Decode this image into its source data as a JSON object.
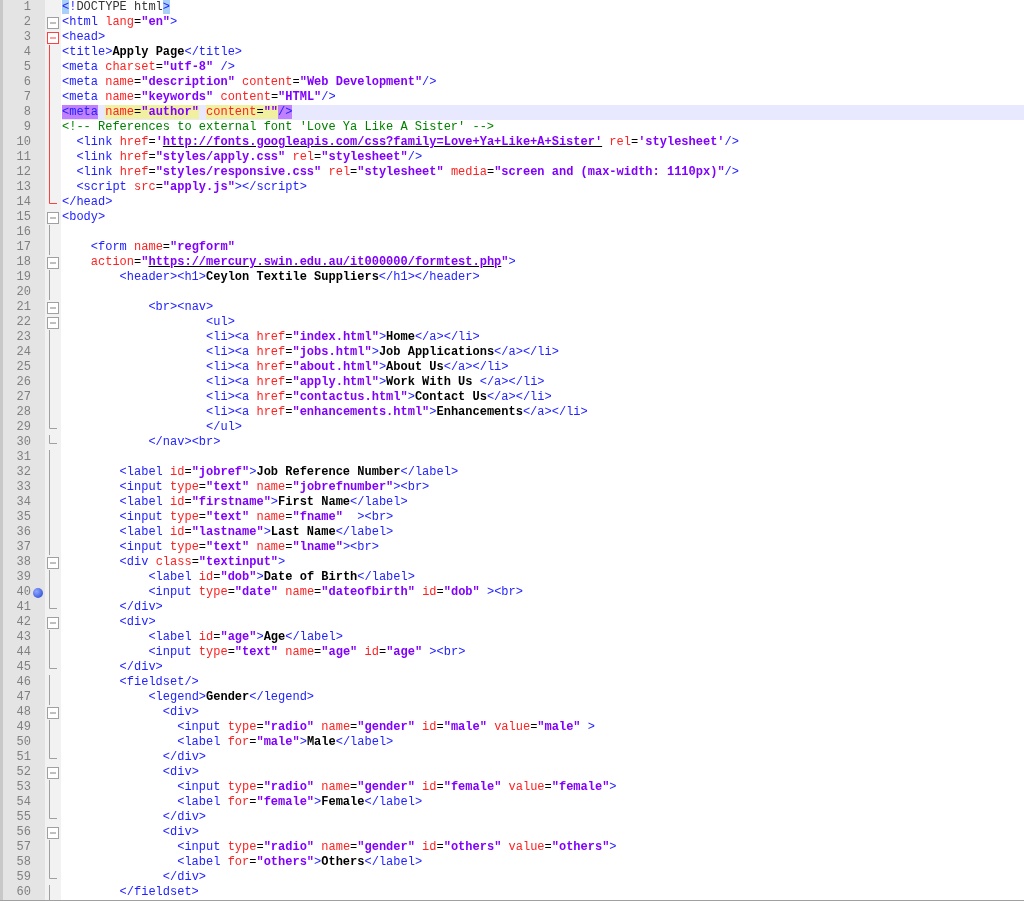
{
  "editor": {
    "lines": [
      {
        "number": "1",
        "current": false,
        "bookmarked": false,
        "tokens": [
          {
            "kind": "tag",
            "text": "<",
            "brace_match": true
          },
          {
            "kind": "tag",
            "text": "!"
          },
          {
            "kind": "plain",
            "text": "DOCTYPE html"
          },
          {
            "kind": "tag",
            "text": ">",
            "brace_match": true
          }
        ]
      },
      {
        "number": "2",
        "current": false,
        "bookmarked": false,
        "fold_start": true,
        "tokens": [
          {
            "kind": "tag",
            "text": "<html"
          },
          {
            "kind": "attr",
            "text": " lang"
          },
          {
            "kind": "op",
            "text": "="
          },
          {
            "kind": "value",
            "text": "\"en\""
          },
          {
            "kind": "tag",
            "text": ">"
          }
        ]
      },
      {
        "number": "3",
        "current": false,
        "bookmarked": false,
        "fold_start": true,
        "in_active_block": true,
        "tokens": [
          {
            "kind": "tag",
            "text": "<head>"
          }
        ]
      },
      {
        "number": "4",
        "current": false,
        "bookmarked": false,
        "in_active_block": true,
        "tokens": [
          {
            "kind": "tag",
            "text": "<title>"
          },
          {
            "kind": "text",
            "text": "Apply Page"
          },
          {
            "kind": "tag",
            "text": "</title>"
          }
        ]
      },
      {
        "number": "5",
        "current": false,
        "bookmarked": false,
        "in_active_block": true,
        "tokens": [
          {
            "kind": "tag",
            "text": "<meta"
          },
          {
            "kind": "attr",
            "text": " charset"
          },
          {
            "kind": "op",
            "text": "="
          },
          {
            "kind": "value",
            "text": "\"utf-8\""
          },
          {
            "kind": "tag",
            "text": " />"
          }
        ]
      },
      {
        "number": "6",
        "current": false,
        "bookmarked": false,
        "in_active_block": true,
        "tokens": [
          {
            "kind": "tag",
            "text": "<meta"
          },
          {
            "kind": "attr",
            "text": " name"
          },
          {
            "kind": "op",
            "text": "="
          },
          {
            "kind": "value",
            "text": "\"description\""
          },
          {
            "kind": "attr",
            "text": " content"
          },
          {
            "kind": "op",
            "text": "="
          },
          {
            "kind": "value",
            "text": "\"Web Development\""
          },
          {
            "kind": "tag",
            "text": "/>"
          }
        ]
      },
      {
        "number": "7",
        "current": false,
        "bookmarked": false,
        "in_active_block": true,
        "tokens": [
          {
            "kind": "tag",
            "text": "<meta"
          },
          {
            "kind": "attr",
            "text": " name"
          },
          {
            "kind": "op",
            "text": "="
          },
          {
            "kind": "value",
            "text": "\"keywords\""
          },
          {
            "kind": "attr",
            "text": " content"
          },
          {
            "kind": "op",
            "text": "="
          },
          {
            "kind": "value",
            "text": "\"HTML\""
          },
          {
            "kind": "tag",
            "text": "/>"
          }
        ]
      },
      {
        "number": "8",
        "current": true,
        "bookmarked": false,
        "in_active_block": true,
        "tokens": [
          {
            "kind": "tag",
            "text": "<meta",
            "tag_match": true
          },
          {
            "kind": "attr",
            "text": " name",
            "smart_highlight": true
          },
          {
            "kind": "op",
            "text": "=",
            "smart_highlight": true
          },
          {
            "kind": "value",
            "text": "\"author\"",
            "smart_highlight": true
          },
          {
            "kind": "attr",
            "text": " content",
            "smart_highlight": true
          },
          {
            "kind": "op",
            "text": "=",
            "smart_highlight": true
          },
          {
            "kind": "value",
            "text": "\"\"",
            "smart_highlight": true
          },
          {
            "kind": "tag",
            "text": "/>",
            "tag_match": true
          }
        ]
      },
      {
        "number": "9",
        "current": false,
        "bookmarked": false,
        "in_active_block": true,
        "tokens": [
          {
            "kind": "comment",
            "text": "<!-- References to external font 'Love Ya Like A Sister' -->"
          }
        ]
      },
      {
        "number": "10",
        "current": false,
        "bookmarked": false,
        "in_active_block": true,
        "tokens": [
          {
            "kind": "tag",
            "text": "  <link"
          },
          {
            "kind": "attr",
            "text": " href"
          },
          {
            "kind": "op",
            "text": "="
          },
          {
            "kind": "value",
            "text": "'"
          },
          {
            "kind": "link",
            "text": "http://fonts.googleapis.com/css?family=Love+Ya+Like+A+Sister'"
          },
          {
            "kind": "attr",
            "text": " rel"
          },
          {
            "kind": "op",
            "text": "="
          },
          {
            "kind": "value",
            "text": "'stylesheet'"
          },
          {
            "kind": "tag",
            "text": "/>"
          }
        ]
      },
      {
        "number": "11",
        "current": false,
        "bookmarked": false,
        "in_active_block": true,
        "tokens": [
          {
            "kind": "tag",
            "text": "  <link"
          },
          {
            "kind": "attr",
            "text": " href"
          },
          {
            "kind": "op",
            "text": "="
          },
          {
            "kind": "value",
            "text": "\"styles/apply.css\""
          },
          {
            "kind": "attr",
            "text": " rel"
          },
          {
            "kind": "op",
            "text": "="
          },
          {
            "kind": "value",
            "text": "\"stylesheet\""
          },
          {
            "kind": "tag",
            "text": "/>"
          }
        ]
      },
      {
        "number": "12",
        "current": false,
        "bookmarked": false,
        "in_active_block": true,
        "tokens": [
          {
            "kind": "tag",
            "text": "  <link"
          },
          {
            "kind": "attr",
            "text": " href"
          },
          {
            "kind": "op",
            "text": "="
          },
          {
            "kind": "value",
            "text": "\"styles/responsive.css\""
          },
          {
            "kind": "attr",
            "text": " rel"
          },
          {
            "kind": "op",
            "text": "="
          },
          {
            "kind": "value",
            "text": "\"stylesheet\""
          },
          {
            "kind": "attr",
            "text": " media"
          },
          {
            "kind": "op",
            "text": "="
          },
          {
            "kind": "value",
            "text": "\"screen and (max-width: 1110px)\""
          },
          {
            "kind": "tag",
            "text": "/>"
          }
        ]
      },
      {
        "number": "13",
        "current": false,
        "bookmarked": false,
        "in_active_block": true,
        "tokens": [
          {
            "kind": "tag",
            "text": "  <script"
          },
          {
            "kind": "attr",
            "text": " src"
          },
          {
            "kind": "op",
            "text": "="
          },
          {
            "kind": "value",
            "text": "\"apply.js\""
          },
          {
            "kind": "tag",
            "text": "></script>"
          }
        ]
      },
      {
        "number": "14",
        "current": false,
        "bookmarked": false,
        "fold_end": true,
        "in_active_block": true,
        "tokens": [
          {
            "kind": "tag",
            "text": "</head>"
          }
        ]
      },
      {
        "number": "15",
        "current": false,
        "bookmarked": false,
        "fold_start": true,
        "tokens": [
          {
            "kind": "tag",
            "text": "<body>"
          }
        ]
      },
      {
        "number": "16",
        "current": false,
        "bookmarked": false
      },
      {
        "number": "17",
        "current": false,
        "bookmarked": false,
        "tokens": [
          {
            "kind": "tag",
            "text": "    <form"
          },
          {
            "kind": "attr",
            "text": " name"
          },
          {
            "kind": "op",
            "text": "="
          },
          {
            "kind": "value",
            "text": "\"regform\""
          }
        ]
      },
      {
        "number": "18",
        "current": false,
        "bookmarked": false,
        "fold_start": true,
        "tokens": [
          {
            "kind": "attr",
            "text": "    action"
          },
          {
            "kind": "op",
            "text": "="
          },
          {
            "kind": "value",
            "text": "\""
          },
          {
            "kind": "link",
            "text": "https://mercury.swin.edu.au/it000000/formtest.php"
          },
          {
            "kind": "value",
            "text": "\""
          },
          {
            "kind": "tag",
            "text": ">"
          }
        ]
      },
      {
        "number": "19",
        "current": false,
        "bookmarked": false,
        "tokens": [
          {
            "kind": "tag",
            "text": "        <header><h1>"
          },
          {
            "kind": "text",
            "text": "Ceylon Textile Suppliers"
          },
          {
            "kind": "tag",
            "text": "</h1></header>"
          }
        ]
      },
      {
        "number": "20",
        "current": false,
        "bookmarked": false
      },
      {
        "number": "21",
        "current": false,
        "bookmarked": false,
        "fold_start": true,
        "tokens": [
          {
            "kind": "tag",
            "text": "            <br><nav>"
          }
        ]
      },
      {
        "number": "22",
        "current": false,
        "bookmarked": false,
        "fold_start": true,
        "tokens": [
          {
            "kind": "tag",
            "text": "                    <ul>"
          }
        ]
      },
      {
        "number": "23",
        "current": false,
        "bookmarked": false,
        "tokens": [
          {
            "kind": "tag",
            "text": "                    <li><a"
          },
          {
            "kind": "attr",
            "text": " href"
          },
          {
            "kind": "op",
            "text": "="
          },
          {
            "kind": "value",
            "text": "\"index.html\""
          },
          {
            "kind": "tag",
            "text": ">"
          },
          {
            "kind": "text",
            "text": "Home"
          },
          {
            "kind": "tag",
            "text": "</a></li>"
          }
        ]
      },
      {
        "number": "24",
        "current": false,
        "bookmarked": false,
        "tokens": [
          {
            "kind": "tag",
            "text": "                    <li><a"
          },
          {
            "kind": "attr",
            "text": " href"
          },
          {
            "kind": "op",
            "text": "="
          },
          {
            "kind": "value",
            "text": "\"jobs.html\""
          },
          {
            "kind": "tag",
            "text": ">"
          },
          {
            "kind": "text",
            "text": "Job Applications"
          },
          {
            "kind": "tag",
            "text": "</a></li>"
          }
        ]
      },
      {
        "number": "25",
        "current": false,
        "bookmarked": false,
        "tokens": [
          {
            "kind": "tag",
            "text": "                    <li><a"
          },
          {
            "kind": "attr",
            "text": " href"
          },
          {
            "kind": "op",
            "text": "="
          },
          {
            "kind": "value",
            "text": "\"about.html\""
          },
          {
            "kind": "tag",
            "text": ">"
          },
          {
            "kind": "text",
            "text": "About Us"
          },
          {
            "kind": "tag",
            "text": "</a></li>"
          }
        ]
      },
      {
        "number": "26",
        "current": false,
        "bookmarked": false,
        "tokens": [
          {
            "kind": "tag",
            "text": "                    <li><a"
          },
          {
            "kind": "attr",
            "text": " href"
          },
          {
            "kind": "op",
            "text": "="
          },
          {
            "kind": "value",
            "text": "\"apply.html\""
          },
          {
            "kind": "tag",
            "text": ">"
          },
          {
            "kind": "text",
            "text": "Work With Us"
          },
          {
            "kind": "tag",
            "text": " </a></li>"
          }
        ]
      },
      {
        "number": "27",
        "current": false,
        "bookmarked": false,
        "tokens": [
          {
            "kind": "tag",
            "text": "                    <li><a"
          },
          {
            "kind": "attr",
            "text": " href"
          },
          {
            "kind": "op",
            "text": "="
          },
          {
            "kind": "value",
            "text": "\"contactus.html\""
          },
          {
            "kind": "tag",
            "text": ">"
          },
          {
            "kind": "text",
            "text": "Contact Us"
          },
          {
            "kind": "tag",
            "text": "</a></li>"
          }
        ]
      },
      {
        "number": "28",
        "current": false,
        "bookmarked": false,
        "tokens": [
          {
            "kind": "tag",
            "text": "                    <li><a"
          },
          {
            "kind": "attr",
            "text": " href"
          },
          {
            "kind": "op",
            "text": "="
          },
          {
            "kind": "value",
            "text": "\"enhancements.html\""
          },
          {
            "kind": "tag",
            "text": ">"
          },
          {
            "kind": "text",
            "text": "Enhancements"
          },
          {
            "kind": "tag",
            "text": "</a></li>"
          }
        ]
      },
      {
        "number": "29",
        "current": false,
        "bookmarked": false,
        "fold_end": true,
        "tokens": [
          {
            "kind": "tag",
            "text": "                    </ul>"
          }
        ]
      },
      {
        "number": "30",
        "current": false,
        "bookmarked": false,
        "fold_end": true,
        "tokens": [
          {
            "kind": "tag",
            "text": "            </nav><br>"
          }
        ]
      },
      {
        "number": "31",
        "current": false,
        "bookmarked": false
      },
      {
        "number": "32",
        "current": false,
        "bookmarked": false,
        "tokens": [
          {
            "kind": "tag",
            "text": "        <label"
          },
          {
            "kind": "attr",
            "text": " id"
          },
          {
            "kind": "op",
            "text": "="
          },
          {
            "kind": "value",
            "text": "\"jobref\""
          },
          {
            "kind": "tag",
            "text": ">"
          },
          {
            "kind": "text",
            "text": "Job Reference Number"
          },
          {
            "kind": "tag",
            "text": "</label>"
          }
        ]
      },
      {
        "number": "33",
        "current": false,
        "bookmarked": false,
        "tokens": [
          {
            "kind": "tag",
            "text": "        <input"
          },
          {
            "kind": "attr",
            "text": " type"
          },
          {
            "kind": "op",
            "text": "="
          },
          {
            "kind": "value",
            "text": "\"text\""
          },
          {
            "kind": "attr",
            "text": " name"
          },
          {
            "kind": "op",
            "text": "="
          },
          {
            "kind": "value",
            "text": "\"jobrefnumber\""
          },
          {
            "kind": "tag",
            "text": "><br>"
          }
        ]
      },
      {
        "number": "34",
        "current": false,
        "bookmarked": false,
        "tokens": [
          {
            "kind": "tag",
            "text": "        <label"
          },
          {
            "kind": "attr",
            "text": " id"
          },
          {
            "kind": "op",
            "text": "="
          },
          {
            "kind": "value",
            "text": "\"firstname\""
          },
          {
            "kind": "tag",
            "text": ">"
          },
          {
            "kind": "text",
            "text": "First Name"
          },
          {
            "kind": "tag",
            "text": "</label>"
          }
        ]
      },
      {
        "number": "35",
        "current": false,
        "bookmarked": false,
        "tokens": [
          {
            "kind": "tag",
            "text": "        <input"
          },
          {
            "kind": "attr",
            "text": " type"
          },
          {
            "kind": "op",
            "text": "="
          },
          {
            "kind": "value",
            "text": "\"text\""
          },
          {
            "kind": "attr",
            "text": " name"
          },
          {
            "kind": "op",
            "text": "="
          },
          {
            "kind": "value",
            "text": "\"fname\""
          },
          {
            "kind": "tag",
            "text": "  ><br>"
          }
        ]
      },
      {
        "number": "36",
        "current": false,
        "bookmarked": false,
        "tokens": [
          {
            "kind": "tag",
            "text": "        <label"
          },
          {
            "kind": "attr",
            "text": " id"
          },
          {
            "kind": "op",
            "text": "="
          },
          {
            "kind": "value",
            "text": "\"lastname\""
          },
          {
            "kind": "tag",
            "text": ">"
          },
          {
            "kind": "text",
            "text": "Last Name"
          },
          {
            "kind": "tag",
            "text": "</label>"
          }
        ]
      },
      {
        "number": "37",
        "current": false,
        "bookmarked": false,
        "tokens": [
          {
            "kind": "tag",
            "text": "        <input"
          },
          {
            "kind": "attr",
            "text": " type"
          },
          {
            "kind": "op",
            "text": "="
          },
          {
            "kind": "value",
            "text": "\"text\""
          },
          {
            "kind": "attr",
            "text": " name"
          },
          {
            "kind": "op",
            "text": "="
          },
          {
            "kind": "value",
            "text": "\"lname\""
          },
          {
            "kind": "tag",
            "text": "><br>"
          }
        ]
      },
      {
        "number": "38",
        "current": false,
        "bookmarked": false,
        "fold_start": true,
        "tokens": [
          {
            "kind": "tag",
            "text": "        <div"
          },
          {
            "kind": "attr",
            "text": " class"
          },
          {
            "kind": "op",
            "text": "="
          },
          {
            "kind": "value",
            "text": "\"textinput\""
          },
          {
            "kind": "tag",
            "text": ">"
          }
        ]
      },
      {
        "number": "39",
        "current": false,
        "bookmarked": false,
        "tokens": [
          {
            "kind": "tag",
            "text": "            <label"
          },
          {
            "kind": "attr",
            "text": " id"
          },
          {
            "kind": "op",
            "text": "="
          },
          {
            "kind": "value",
            "text": "\"dob\""
          },
          {
            "kind": "tag",
            "text": ">"
          },
          {
            "kind": "text",
            "text": "Date of Birth"
          },
          {
            "kind": "tag",
            "text": "</label>"
          }
        ]
      },
      {
        "number": "40",
        "current": false,
        "bookmarked": true,
        "tokens": [
          {
            "kind": "tag",
            "text": "            <input"
          },
          {
            "kind": "attr",
            "text": " type"
          },
          {
            "kind": "op",
            "text": "="
          },
          {
            "kind": "value",
            "text": "\"date\""
          },
          {
            "kind": "attr",
            "text": " name"
          },
          {
            "kind": "op",
            "text": "="
          },
          {
            "kind": "value",
            "text": "\"dateofbirth\""
          },
          {
            "kind": "attr",
            "text": " id"
          },
          {
            "kind": "op",
            "text": "="
          },
          {
            "kind": "value",
            "text": "\"dob\""
          },
          {
            "kind": "tag",
            "text": " ><br>"
          }
        ]
      },
      {
        "number": "41",
        "current": false,
        "bookmarked": false,
        "fold_end": true,
        "tokens": [
          {
            "kind": "tag",
            "text": "        </div>"
          }
        ]
      },
      {
        "number": "42",
        "current": false,
        "bookmarked": false,
        "fold_start": true,
        "tokens": [
          {
            "kind": "tag",
            "text": "        <div>"
          }
        ]
      },
      {
        "number": "43",
        "current": false,
        "bookmarked": false,
        "tokens": [
          {
            "kind": "tag",
            "text": "            <label"
          },
          {
            "kind": "attr",
            "text": " id"
          },
          {
            "kind": "op",
            "text": "="
          },
          {
            "kind": "value",
            "text": "\"age\""
          },
          {
            "kind": "tag",
            "text": ">"
          },
          {
            "kind": "text",
            "text": "Age"
          },
          {
            "kind": "tag",
            "text": "</label>"
          }
        ]
      },
      {
        "number": "44",
        "current": false,
        "bookmarked": false,
        "tokens": [
          {
            "kind": "tag",
            "text": "            <input"
          },
          {
            "kind": "attr",
            "text": " type"
          },
          {
            "kind": "op",
            "text": "="
          },
          {
            "kind": "value",
            "text": "\"text\""
          },
          {
            "kind": "attr",
            "text": " name"
          },
          {
            "kind": "op",
            "text": "="
          },
          {
            "kind": "value",
            "text": "\"age\""
          },
          {
            "kind": "attr",
            "text": " id"
          },
          {
            "kind": "op",
            "text": "="
          },
          {
            "kind": "value",
            "text": "\"age\""
          },
          {
            "kind": "tag",
            "text": " ><br>"
          }
        ]
      },
      {
        "number": "45",
        "current": false,
        "bookmarked": false,
        "fold_end": true,
        "tokens": [
          {
            "kind": "tag",
            "text": "        </div>"
          }
        ]
      },
      {
        "number": "46",
        "current": false,
        "bookmarked": false,
        "tokens": [
          {
            "kind": "tag",
            "text": "        <fieldset/>"
          }
        ]
      },
      {
        "number": "47",
        "current": false,
        "bookmarked": false,
        "tokens": [
          {
            "kind": "tag",
            "text": "            <legend>"
          },
          {
            "kind": "text",
            "text": "Gender"
          },
          {
            "kind": "tag",
            "text": "</legend>"
          }
        ]
      },
      {
        "number": "48",
        "current": false,
        "bookmarked": false,
        "fold_start": true,
        "tokens": [
          {
            "kind": "tag",
            "text": "              <div>"
          }
        ]
      },
      {
        "number": "49",
        "current": false,
        "bookmarked": false,
        "tokens": [
          {
            "kind": "tag",
            "text": "                <input"
          },
          {
            "kind": "attr",
            "text": " type"
          },
          {
            "kind": "op",
            "text": "="
          },
          {
            "kind": "value",
            "text": "\"radio\""
          },
          {
            "kind": "attr",
            "text": " name"
          },
          {
            "kind": "op",
            "text": "="
          },
          {
            "kind": "value",
            "text": "\"gender\""
          },
          {
            "kind": "attr",
            "text": " id"
          },
          {
            "kind": "op",
            "text": "="
          },
          {
            "kind": "value",
            "text": "\"male\""
          },
          {
            "kind": "attr",
            "text": " value"
          },
          {
            "kind": "op",
            "text": "="
          },
          {
            "kind": "value",
            "text": "\"male\""
          },
          {
            "kind": "tag",
            "text": " >"
          }
        ]
      },
      {
        "number": "50",
        "current": false,
        "bookmarked": false,
        "tokens": [
          {
            "kind": "tag",
            "text": "                <label"
          },
          {
            "kind": "attr",
            "text": " for"
          },
          {
            "kind": "op",
            "text": "="
          },
          {
            "kind": "value",
            "text": "\"male\""
          },
          {
            "kind": "tag",
            "text": ">"
          },
          {
            "kind": "text",
            "text": "Male"
          },
          {
            "kind": "tag",
            "text": "</label>"
          }
        ]
      },
      {
        "number": "51",
        "current": false,
        "bookmarked": false,
        "fold_end": true,
        "tokens": [
          {
            "kind": "tag",
            "text": "              </div>"
          }
        ]
      },
      {
        "number": "52",
        "current": false,
        "bookmarked": false,
        "fold_start": true,
        "tokens": [
          {
            "kind": "tag",
            "text": "              <div>"
          }
        ]
      },
      {
        "number": "53",
        "current": false,
        "bookmarked": false,
        "tokens": [
          {
            "kind": "tag",
            "text": "                <input"
          },
          {
            "kind": "attr",
            "text": " type"
          },
          {
            "kind": "op",
            "text": "="
          },
          {
            "kind": "value",
            "text": "\"radio\""
          },
          {
            "kind": "attr",
            "text": " name"
          },
          {
            "kind": "op",
            "text": "="
          },
          {
            "kind": "value",
            "text": "\"gender\""
          },
          {
            "kind": "attr",
            "text": " id"
          },
          {
            "kind": "op",
            "text": "="
          },
          {
            "kind": "value",
            "text": "\"female\""
          },
          {
            "kind": "attr",
            "text": " value"
          },
          {
            "kind": "op",
            "text": "="
          },
          {
            "kind": "value",
            "text": "\"female\""
          },
          {
            "kind": "tag",
            "text": ">"
          }
        ]
      },
      {
        "number": "54",
        "current": false,
        "bookmarked": false,
        "tokens": [
          {
            "kind": "tag",
            "text": "                <label"
          },
          {
            "kind": "attr",
            "text": " for"
          },
          {
            "kind": "op",
            "text": "="
          },
          {
            "kind": "value",
            "text": "\"female\""
          },
          {
            "kind": "tag",
            "text": ">"
          },
          {
            "kind": "text",
            "text": "Female"
          },
          {
            "kind": "tag",
            "text": "</label>"
          }
        ]
      },
      {
        "number": "55",
        "current": false,
        "bookmarked": false,
        "fold_end": true,
        "tokens": [
          {
            "kind": "tag",
            "text": "              </div>"
          }
        ]
      },
      {
        "number": "56",
        "current": false,
        "bookmarked": false,
        "fold_start": true,
        "tokens": [
          {
            "kind": "tag",
            "text": "              <div>"
          }
        ]
      },
      {
        "number": "57",
        "current": false,
        "bookmarked": false,
        "tokens": [
          {
            "kind": "tag",
            "text": "                <input"
          },
          {
            "kind": "attr",
            "text": " type"
          },
          {
            "kind": "op",
            "text": "="
          },
          {
            "kind": "value",
            "text": "\"radio\""
          },
          {
            "kind": "attr",
            "text": " name"
          },
          {
            "kind": "op",
            "text": "="
          },
          {
            "kind": "value",
            "text": "\"gender\""
          },
          {
            "kind": "attr",
            "text": " id"
          },
          {
            "kind": "op",
            "text": "="
          },
          {
            "kind": "value",
            "text": "\"others\""
          },
          {
            "kind": "attr",
            "text": " value"
          },
          {
            "kind": "op",
            "text": "="
          },
          {
            "kind": "value",
            "text": "\"others\""
          },
          {
            "kind": "tag",
            "text": ">"
          }
        ]
      },
      {
        "number": "58",
        "current": false,
        "bookmarked": false,
        "tokens": [
          {
            "kind": "tag",
            "text": "                <label"
          },
          {
            "kind": "attr",
            "text": " for"
          },
          {
            "kind": "op",
            "text": "="
          },
          {
            "kind": "value",
            "text": "\"others\""
          },
          {
            "kind": "tag",
            "text": ">"
          },
          {
            "kind": "text",
            "text": "Others"
          },
          {
            "kind": "tag",
            "text": "</label>"
          }
        ]
      },
      {
        "number": "59",
        "current": false,
        "bookmarked": false,
        "fold_end": true,
        "tokens": [
          {
            "kind": "tag",
            "text": "              </div>"
          }
        ]
      },
      {
        "number": "60",
        "current": false,
        "bookmarked": false,
        "tokens": [
          {
            "kind": "tag",
            "text": "        </fieldset>"
          }
        ]
      }
    ]
  }
}
